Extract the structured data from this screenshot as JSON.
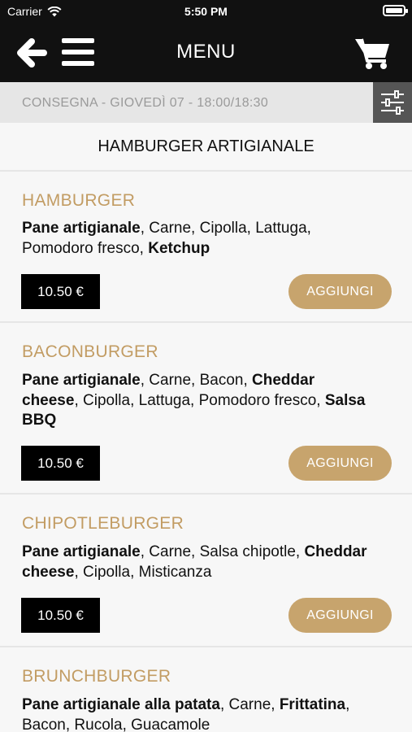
{
  "status_bar": {
    "carrier": "Carrier",
    "time": "5:50 PM"
  },
  "header": {
    "title": "MENU"
  },
  "delivery": {
    "text": "CONSEGNA - GIOVEDÌ 07 - 18:00/18:30"
  },
  "category": {
    "title": "HAMBURGER ARTIGIANALE"
  },
  "items": [
    {
      "name": "HAMBURGER",
      "desc": [
        {
          "text": "Pane artigianale",
          "bold": true
        },
        {
          "text": ", Carne, Cipolla, Lattuga, Pomodoro fresco, ",
          "bold": false
        },
        {
          "text": "Ketchup",
          "bold": true
        }
      ],
      "price": "10.50 €",
      "add_label": "AGGIUNGI"
    },
    {
      "name": "BACONBURGER",
      "desc": [
        {
          "text": "Pane artigianale",
          "bold": true
        },
        {
          "text": ", Carne, Bacon, ",
          "bold": false
        },
        {
          "text": "Cheddar cheese",
          "bold": true
        },
        {
          "text": ", Cipolla, Lattuga, Pomodoro fresco, ",
          "bold": false
        },
        {
          "text": "Salsa BBQ",
          "bold": true
        }
      ],
      "price": "10.50 €",
      "add_label": "AGGIUNGI"
    },
    {
      "name": "CHIPOTLEBURGER",
      "desc": [
        {
          "text": "Pane artigianale",
          "bold": true
        },
        {
          "text": ", Carne, Salsa chipotle, ",
          "bold": false
        },
        {
          "text": "Cheddar cheese",
          "bold": true
        },
        {
          "text": ", Cipolla, Misticanza",
          "bold": false
        }
      ],
      "price": "10.50 €",
      "add_label": "AGGIUNGI"
    },
    {
      "name": "BRUNCHBURGER",
      "desc": [
        {
          "text": "Pane artigianale alla patata",
          "bold": true
        },
        {
          "text": ", Carne, ",
          "bold": false
        },
        {
          "text": "Frittatina",
          "bold": true
        },
        {
          "text": ", Bacon, Rucola, Guacamole",
          "bold": false
        }
      ]
    }
  ]
}
